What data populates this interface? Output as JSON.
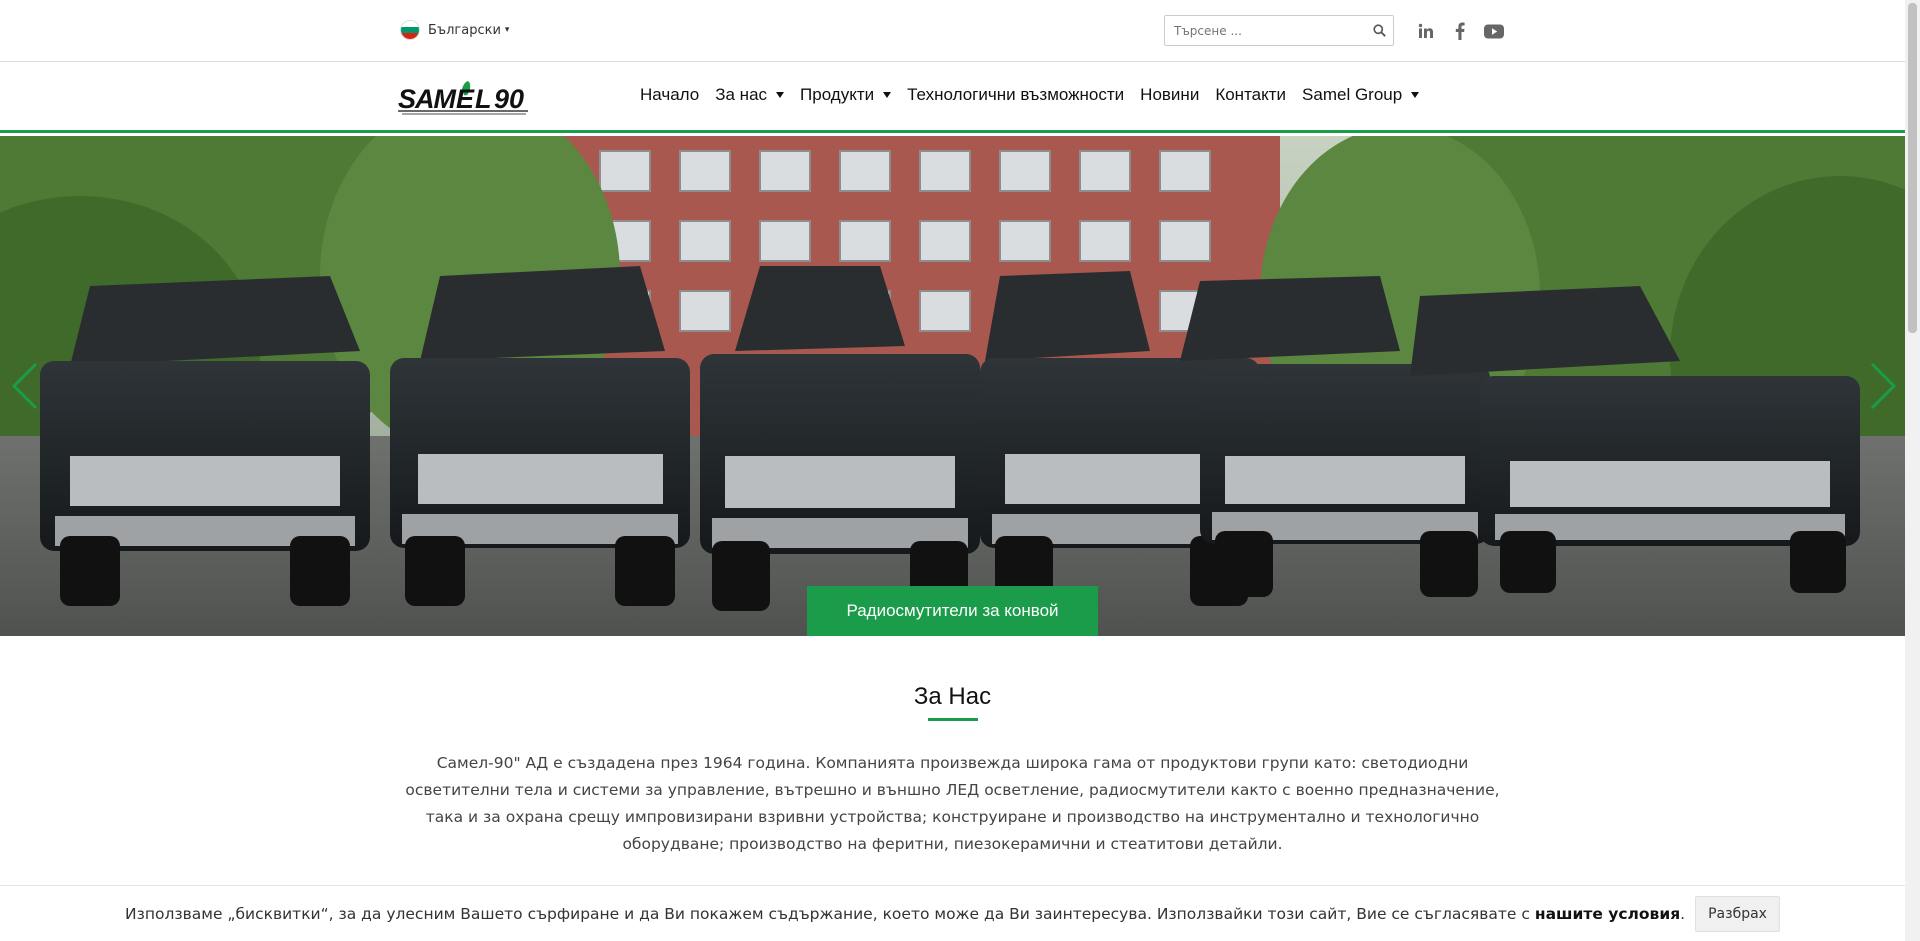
{
  "topbar": {
    "language": "Български",
    "flag_colors": [
      "#ffffff",
      "#00966e",
      "#d62612"
    ],
    "search_placeholder": "Търсене ...",
    "social": [
      "linkedin-icon",
      "facebook-icon",
      "youtube-icon"
    ]
  },
  "nav": {
    "logo_text": "SAMEL 90",
    "items": [
      {
        "label": "Начало"
      },
      {
        "label": "За нас"
      },
      {
        "label": "Продукти"
      },
      {
        "label": "Технологични възможности"
      },
      {
        "label": "Новини"
      },
      {
        "label": "Контакти"
      },
      {
        "label": "Samel Group"
      }
    ],
    "accent": "#1a9c4a"
  },
  "hero": {
    "caption": "Радиосмутители за конвой"
  },
  "about": {
    "title": "За Нас",
    "text": "Самел-90\" АД е създадена през 1964 година. Компанията произвежда широка гама от продуктови групи като: светодиодни осветителни тела и системи за управление, вътрешно и външно ЛЕД осветление, радиосмутители както с военно предназначение, така и за охрана срещу импровизирани взривни устройства; конструиране и производство на инструментално и технологично  оборудване; производство на феритни, пиезокерамични и стеатитови детайли."
  },
  "cookie": {
    "text": "Използваме „бисквитки“, за да улесним Вашето сърфиране и да Ви покажем съдържание, което може да Ви заинтересува. Използвайки този сайт, Вие се съгласявате с",
    "link": "нашите условия",
    "dot": ".",
    "button": "Разбрах"
  }
}
